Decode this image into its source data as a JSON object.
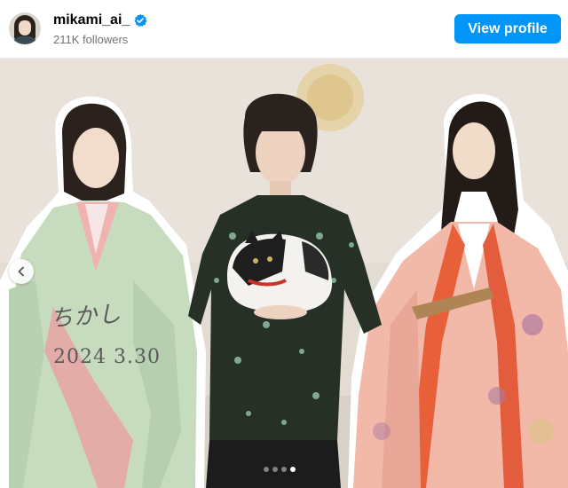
{
  "header": {
    "username": "mikami_ai_",
    "verified": true,
    "followers": "211K followers",
    "view_profile_label": "View profile"
  },
  "post": {
    "carousel": {
      "slide_count": 4,
      "active_index": 4
    },
    "handwriting": {
      "name": "ちかし",
      "date": "2024 3.30"
    }
  },
  "colors": {
    "primary_button": "#0095f6",
    "verified_badge": "#0095f6"
  },
  "icons": {
    "verified": "verified-badge-icon",
    "previous": "chevron-left-icon"
  }
}
